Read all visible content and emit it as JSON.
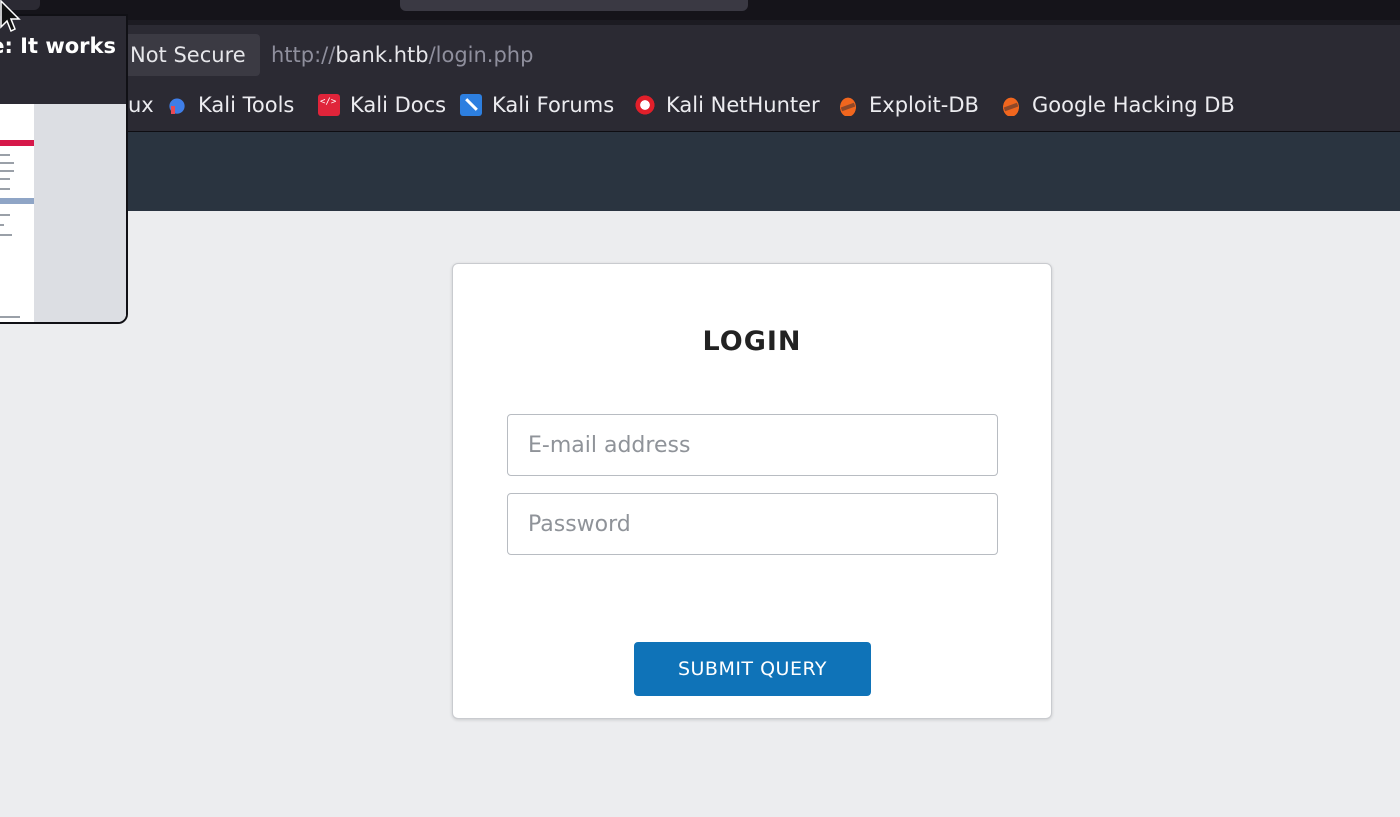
{
  "browser": {
    "security_label": "Not Secure",
    "url": {
      "scheme": "http://",
      "host": "bank.htb",
      "path": "/login.php"
    },
    "bookmarks": [
      {
        "label": "ux",
        "icon": "kali-linux-icon"
      },
      {
        "label": "Kali Tools",
        "icon": "kali-tools-icon"
      },
      {
        "label": "Kali Docs",
        "icon": "kali-docs-icon"
      },
      {
        "label": "Kali Forums",
        "icon": "kali-forums-icon"
      },
      {
        "label": "Kali NetHunter",
        "icon": "kali-nethunter-icon"
      },
      {
        "label": "Exploit-DB",
        "icon": "exploit-db-icon"
      },
      {
        "label": "Google Hacking DB",
        "icon": "google-hacking-db-icon"
      }
    ],
    "tab_preview_title": "e: It works"
  },
  "login": {
    "heading": "LOGIN",
    "email_placeholder": "E-mail address",
    "password_placeholder": "Password",
    "submit_label": "SUBMIT QUERY"
  },
  "colors": {
    "submit": "#0f73b8",
    "site_header": "#2a3440",
    "background": "#ecedef"
  }
}
